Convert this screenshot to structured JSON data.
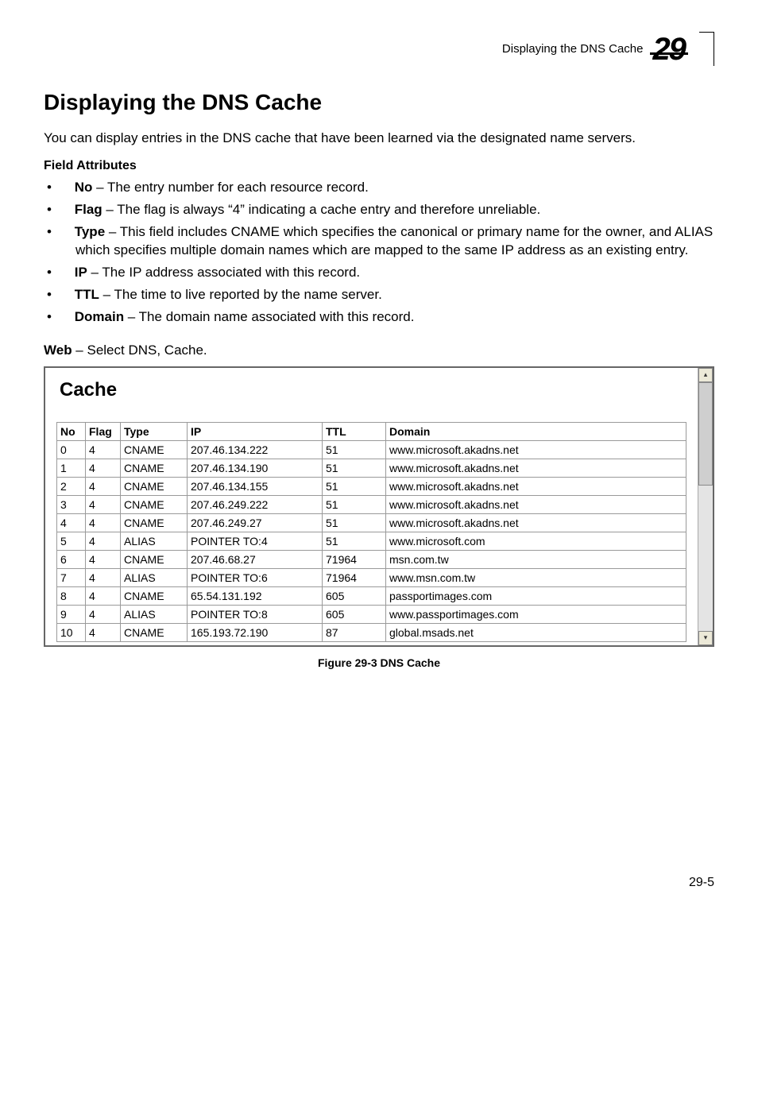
{
  "header": {
    "running_title": "Displaying the DNS Cache",
    "chapter_number": "29"
  },
  "title": "Displaying the DNS Cache",
  "intro": "You can display entries in the DNS cache that have been learned via the designated name servers.",
  "field_attributes_heading": "Field Attributes",
  "attrs": [
    {
      "name": "No",
      "desc": " – The entry number for each resource record."
    },
    {
      "name": "Flag",
      "desc": " – The flag is always “4” indicating a cache entry and therefore unreliable."
    },
    {
      "name": "Type",
      "desc": " – This field includes CNAME which specifies the canonical or primary name for the owner, and ALIAS which specifies multiple domain names which are mapped to the same IP address as an existing entry."
    },
    {
      "name": "IP",
      "desc": " – The IP address associated with this record."
    },
    {
      "name": "TTL",
      "desc": " – The time to live reported by the name server."
    },
    {
      "name": "Domain",
      "desc": " – The domain name associated with this record."
    }
  ],
  "web_line_prefix": "Web",
  "web_line_rest": " – Select DNS, Cache.",
  "cache_panel_title": "Cache",
  "table": {
    "headers": [
      "No",
      "Flag",
      "Type",
      "IP",
      "TTL",
      "Domain"
    ],
    "rows": [
      [
        "0",
        "4",
        "CNAME",
        "207.46.134.222",
        "51",
        "www.microsoft.akadns.net"
      ],
      [
        "1",
        "4",
        "CNAME",
        "207.46.134.190",
        "51",
        "www.microsoft.akadns.net"
      ],
      [
        "2",
        "4",
        "CNAME",
        "207.46.134.155",
        "51",
        "www.microsoft.akadns.net"
      ],
      [
        "3",
        "4",
        "CNAME",
        "207.46.249.222",
        "51",
        "www.microsoft.akadns.net"
      ],
      [
        "4",
        "4",
        "CNAME",
        "207.46.249.27",
        "51",
        "www.microsoft.akadns.net"
      ],
      [
        "5",
        "4",
        "ALIAS",
        "POINTER TO:4",
        "51",
        "www.microsoft.com"
      ],
      [
        "6",
        "4",
        "CNAME",
        "207.46.68.27",
        "71964",
        "msn.com.tw"
      ],
      [
        "7",
        "4",
        "ALIAS",
        "POINTER TO:6",
        "71964",
        "www.msn.com.tw"
      ],
      [
        "8",
        "4",
        "CNAME",
        "65.54.131.192",
        "605",
        "passportimages.com"
      ],
      [
        "9",
        "4",
        "ALIAS",
        "POINTER TO:8",
        "605",
        "www.passportimages.com"
      ],
      [
        "10",
        "4",
        "CNAME",
        "165.193.72.190",
        "87",
        "global.msads.net"
      ]
    ]
  },
  "figure_caption": "Figure 29-3  DNS Cache",
  "page_number": "29-5",
  "scroll_up_glyph": "▴",
  "scroll_down_glyph": "▾"
}
